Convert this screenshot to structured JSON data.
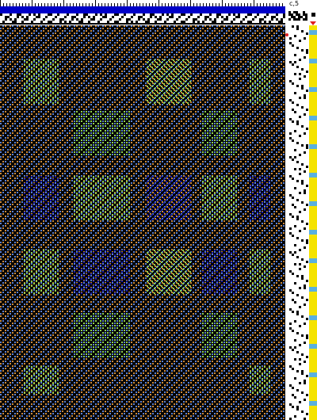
{
  "corner": {
    "label": "c,5"
  },
  "colors": {
    "warp": "#0000c8",
    "weft": "#f5e300",
    "background": "#000000",
    "ground_a": "#c9893a",
    "ground_b": "#5a7fd0",
    "motif_green": "#8fd14f",
    "motif_blue": "#1818a8",
    "marker_red": "#e02020"
  },
  "icons": [
    "ruler-tick-icon",
    "weft-arrow-icon",
    "red-dot-marker-icon"
  ]
}
